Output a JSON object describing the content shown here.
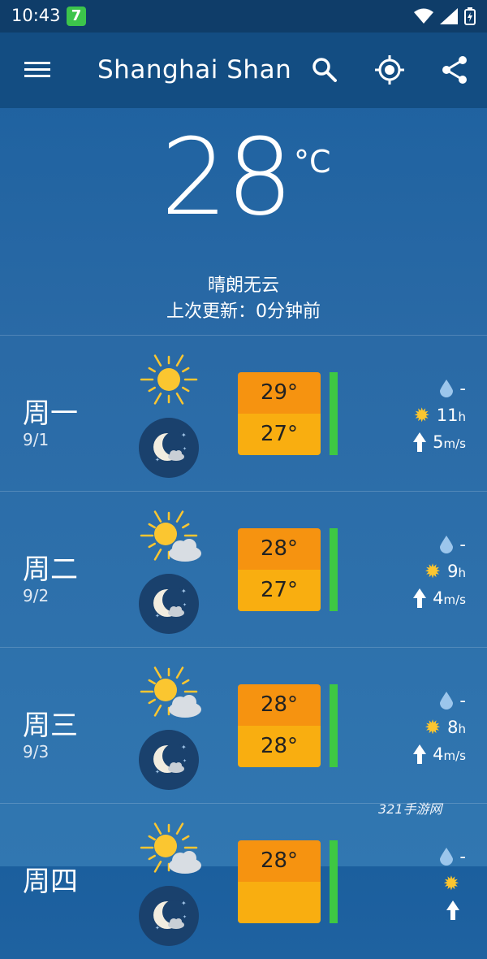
{
  "status": {
    "time": "10:43",
    "badge": "7"
  },
  "app_bar": {
    "city": "Shanghai Shan"
  },
  "current": {
    "temperature": "28",
    "unit": "°C",
    "condition": "晴朗无云",
    "updated": "上次更新：0分钟前"
  },
  "days": [
    {
      "name": "周一",
      "date": "9/1",
      "high": "29°",
      "low": "27°",
      "rain": "-",
      "sun_hours": "11",
      "sun_unit": "h",
      "wind": "5",
      "wind_unit": "m/s",
      "day_icon": "sun-icon"
    },
    {
      "name": "周二",
      "date": "9/2",
      "high": "28°",
      "low": "27°",
      "rain": "-",
      "sun_hours": "9",
      "sun_unit": "h",
      "wind": "4",
      "wind_unit": "m/s",
      "day_icon": "partly-cloudy-icon"
    },
    {
      "name": "周三",
      "date": "9/3",
      "high": "28°",
      "low": "28°",
      "rain": "-",
      "sun_hours": "8",
      "sun_unit": "h",
      "wind": "4",
      "wind_unit": "m/s",
      "day_icon": "partly-cloudy-icon"
    },
    {
      "name": "周四",
      "date": "",
      "high": "28°",
      "low": "",
      "rain": "-",
      "sun_hours": "",
      "sun_unit": "",
      "wind": "",
      "wind_unit": "",
      "day_icon": "partly-cloudy-icon"
    }
  ],
  "watermark": "321手游网"
}
